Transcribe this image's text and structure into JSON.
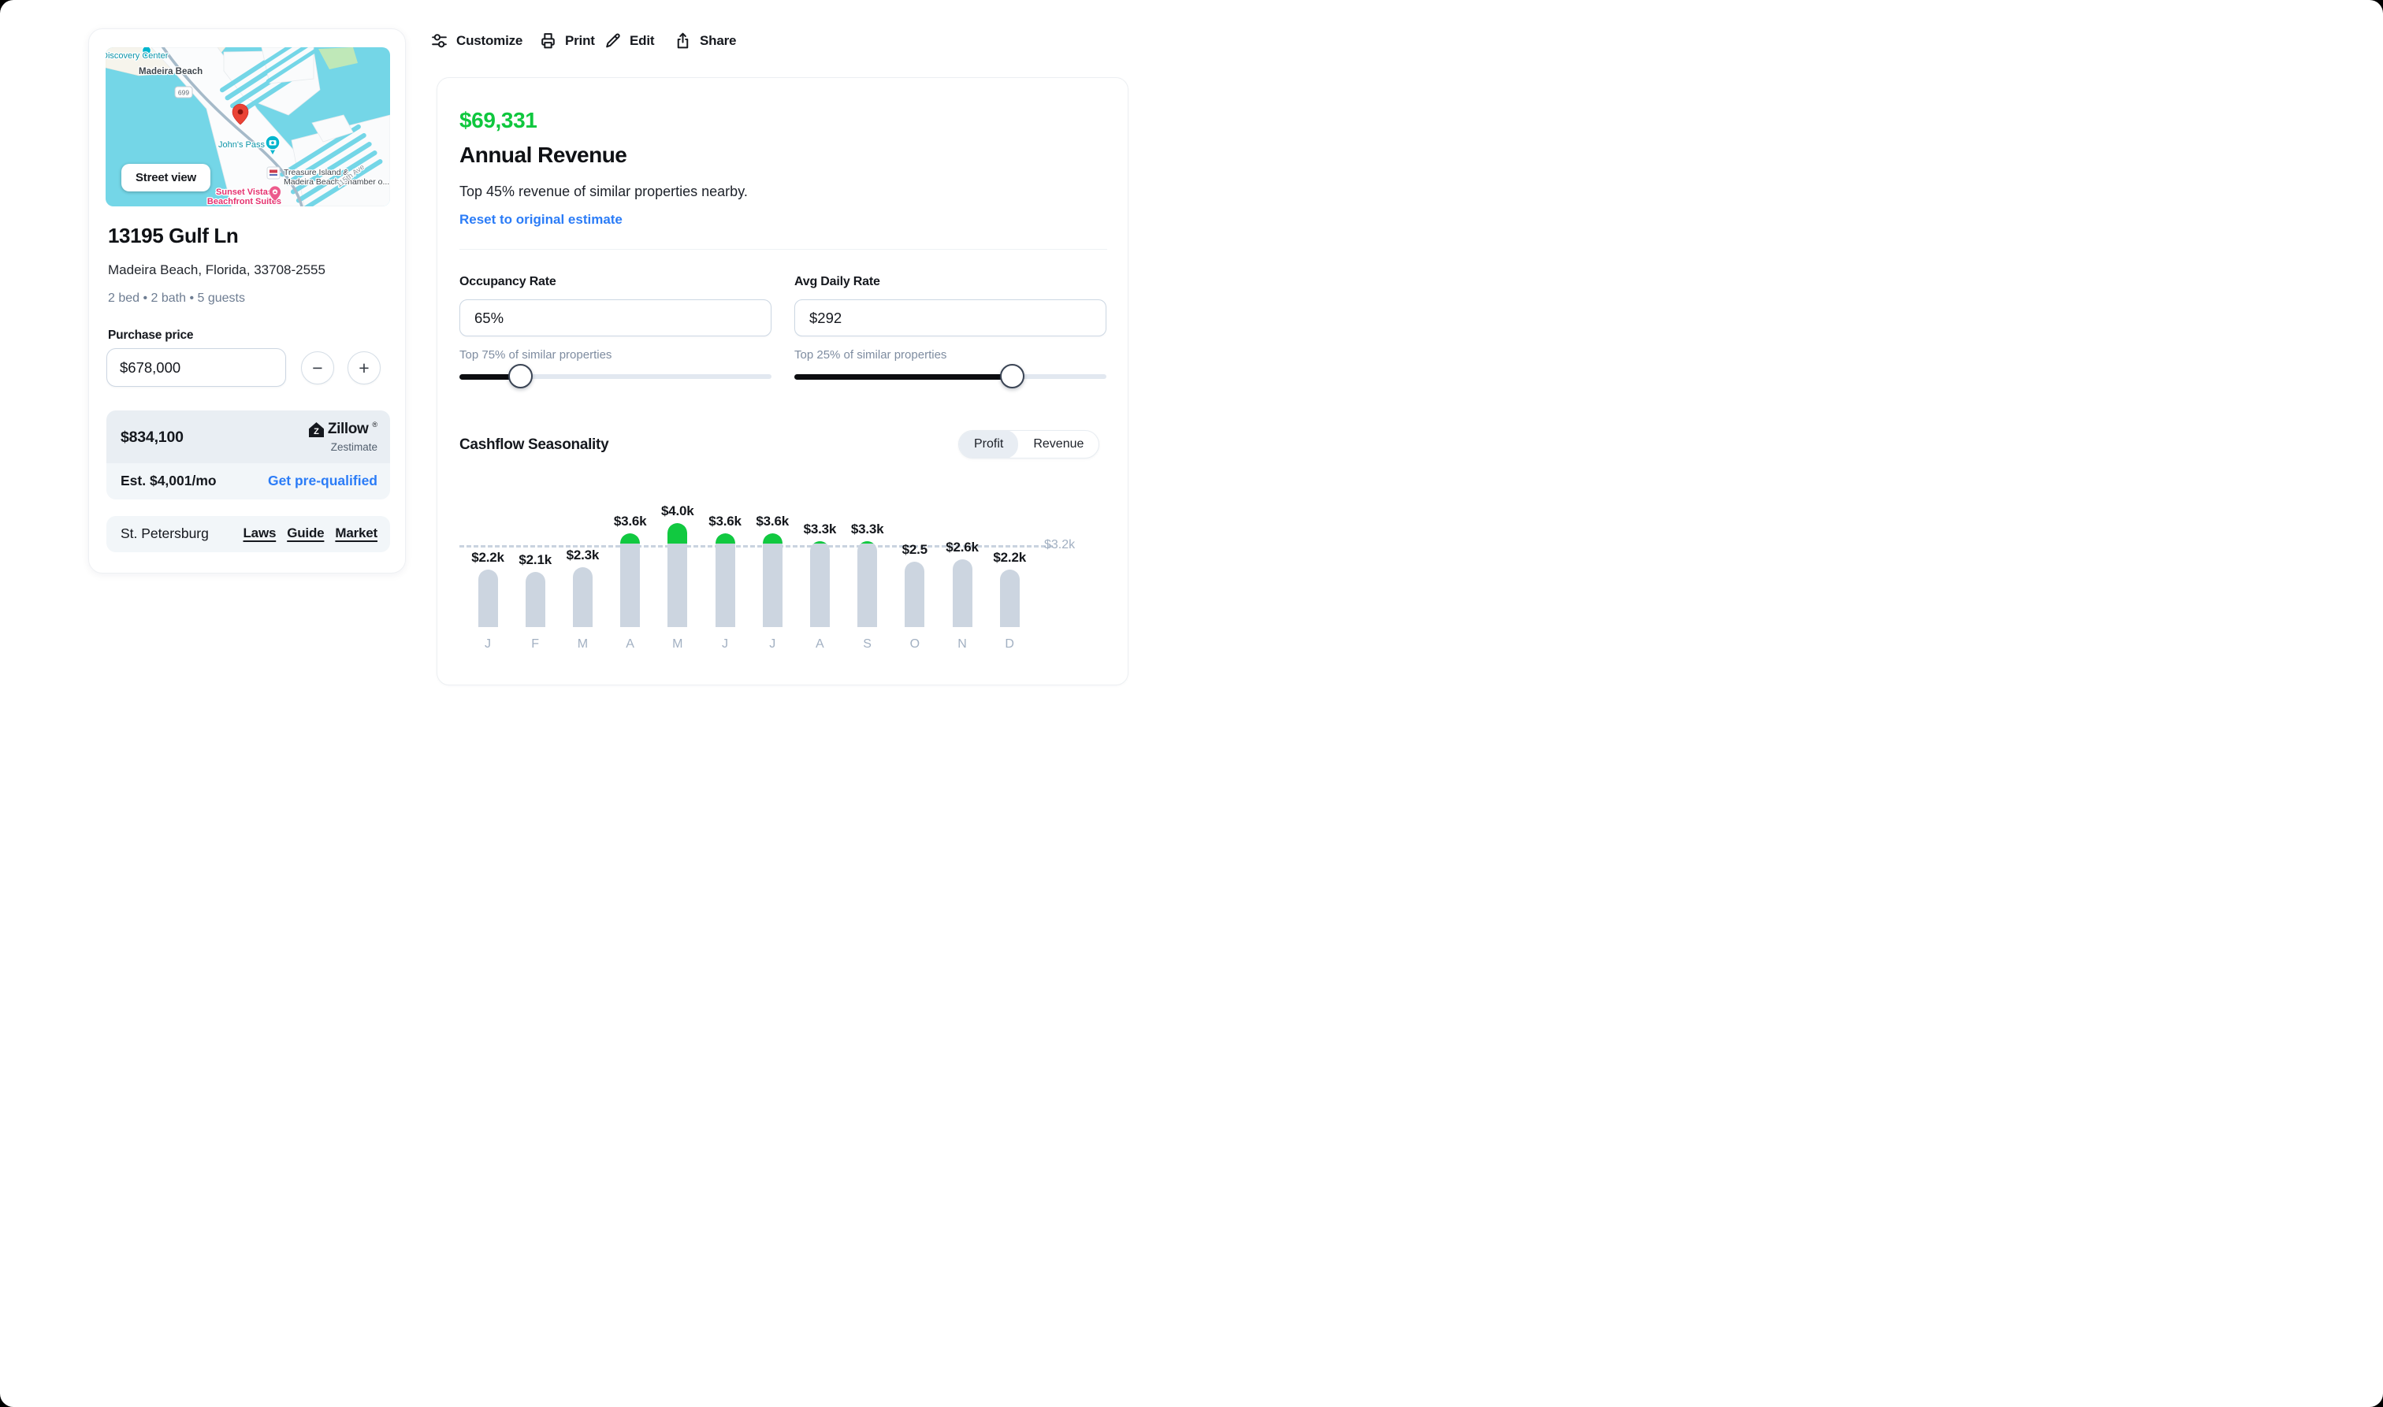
{
  "toolbar": {
    "items": [
      {
        "label": "Customize",
        "icon": "sliders-icon"
      },
      {
        "label": "Print",
        "icon": "printer-icon"
      },
      {
        "label": "Edit",
        "icon": "pencil-icon"
      },
      {
        "label": "Share",
        "icon": "share-icon"
      }
    ]
  },
  "property_card": {
    "map": {
      "street_view_button": "Street view",
      "labels": {
        "discovery": "Discovery Center",
        "city": "Madeira Beach",
        "route_shield": "699",
        "johns_pass": "John's Pass",
        "chamber_line1": "Treasure Island &",
        "chamber_line2": "Madeira Beach Chamber o...",
        "sunset_line1": "Sunset Vistas",
        "sunset_line2": "Beachfront Suites",
        "street": "115th Ave"
      }
    },
    "address": "13195 Gulf Ln",
    "location": "Madeira Beach, Florida, 33708-2555",
    "specs": "2 bed • 2 bath • 5 guests",
    "purchase_price": {
      "label": "Purchase price",
      "value": "$678,000",
      "decrement_label": "−",
      "increment_label": "+"
    },
    "zestimate": {
      "value": "$834,100",
      "brand": "Zillow",
      "registered_mark": "®",
      "brand_caption": "Zestimate",
      "monthly_estimate": "Est. $4,001/mo",
      "cta": "Get pre-qualified"
    },
    "market_row": {
      "city": "St. Petersburg",
      "links": [
        {
          "label": "Laws"
        },
        {
          "label": "Guide"
        },
        {
          "label": "Market"
        }
      ]
    }
  },
  "revenue_panel": {
    "amount": "$69,331",
    "amount_color": "#0fc73e",
    "title": "Annual Revenue",
    "subtitle": "Top 45% revenue of similar properties nearby.",
    "reset_link": "Reset to original estimate",
    "occupancy": {
      "label": "Occupancy Rate",
      "value": "65%",
      "hint": "Top 75% of similar properties",
      "slider_percent": 19.5
    },
    "daily_rate": {
      "label": "Avg Daily Rate",
      "value": "$292",
      "hint": "Top 25% of similar properties",
      "slider_percent": 69.7
    },
    "seasonality": {
      "title": "Cashflow Seasonality",
      "toggle_options": [
        "Profit",
        "Revenue"
      ],
      "active_option": "Profit"
    }
  },
  "chart_data": {
    "type": "bar",
    "title": "Cashflow Seasonality",
    "categories": [
      "J",
      "F",
      "M",
      "A",
      "M",
      "J",
      "J",
      "A",
      "S",
      "O",
      "N",
      "D"
    ],
    "values": [
      2200,
      2100,
      2300,
      3600,
      4000,
      3600,
      3600,
      3300,
      3300,
      2500,
      2600,
      2200
    ],
    "value_labels": [
      "$2.2k",
      "$2.1k",
      "$2.3k",
      "$3.6k",
      "$4.0k",
      "$3.6k",
      "$3.6k",
      "$3.3k",
      "$3.3k",
      "$2.5",
      "$2.6k",
      "$2.2k"
    ],
    "threshold_value": 3200,
    "threshold_label": "$3.2k",
    "unit": "$ per month",
    "ylim": [
      0,
      4000
    ],
    "grid": false,
    "legend": false,
    "colors": {
      "bar": "#ccd5e0",
      "above_threshold": "#11c940",
      "threshold_line": "#c9d3df"
    }
  }
}
